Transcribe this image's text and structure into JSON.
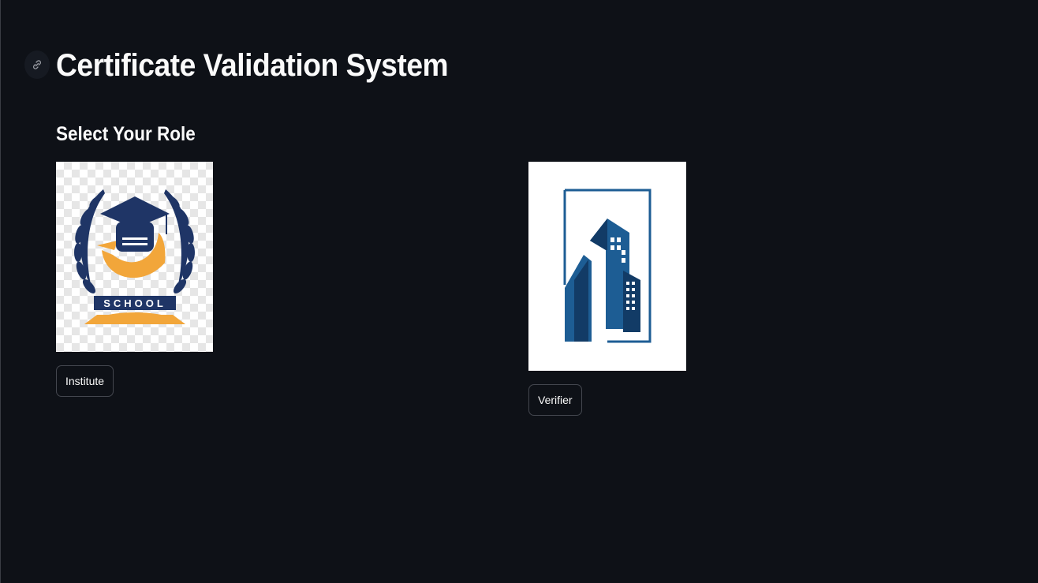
{
  "header": {
    "title": "Certificate Validation System",
    "anchor_icon": "link-icon"
  },
  "roles": {
    "heading": "Select Your Role",
    "institute": {
      "image_icon": "school-logo",
      "logo_text": "SCHOOL",
      "button_label": "Institute"
    },
    "verifier": {
      "image_icon": "building-logo",
      "button_label": "Verifier"
    }
  },
  "colors": {
    "background": "#0e1117",
    "text": "#fafafa",
    "button_border": "#44474f",
    "logo_navy": "#1f3566",
    "logo_orange": "#f2a63a",
    "building_blue": "#1d5d94",
    "building_dark": "#123b66"
  }
}
